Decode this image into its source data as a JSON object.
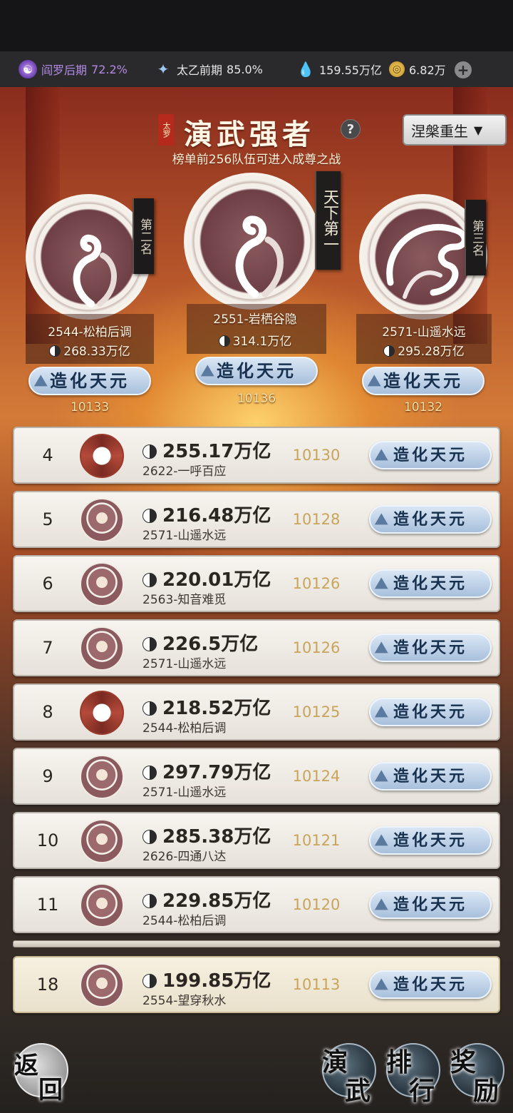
{
  "resources": {
    "realm1": {
      "label": "阎罗后期",
      "value": "72.2%"
    },
    "realm2": {
      "label": "太乙前期",
      "value": "85.0%"
    },
    "currency1": "159.55万亿",
    "currency2": "6.82万"
  },
  "header": {
    "badge": "太罗",
    "title": "演武强者",
    "subtitle": "榜单前256队伍可进入成尊之战",
    "dropdown_value": "涅槃重生"
  },
  "podium": [
    {
      "banner": "第二名",
      "name": "2544-松柏后调",
      "power": "268.33万亿",
      "realm": "造化天元",
      "score": "10133"
    },
    {
      "banner": "天下第一",
      "name": "2551-岩栖谷隐",
      "power": "314.1万亿",
      "realm": "造化天元",
      "score": "10136"
    },
    {
      "banner": "第三名",
      "name": "2571-山遥水远",
      "power": "295.28万亿",
      "realm": "造化天元",
      "score": "10132"
    }
  ],
  "rows": [
    {
      "rank": "4",
      "power": "255.17万亿",
      "team": "2622-一呼百应",
      "score": "10130",
      "realm": "造化天元",
      "emblem": "sword"
    },
    {
      "rank": "5",
      "power": "216.48万亿",
      "team": "2571-山遥水远",
      "score": "10128",
      "realm": "造化天元",
      "emblem": "swirl"
    },
    {
      "rank": "6",
      "power": "220.01万亿",
      "team": "2563-知音难觅",
      "score": "10126",
      "realm": "造化天元",
      "emblem": "swirl"
    },
    {
      "rank": "7",
      "power": "226.5万亿",
      "team": "2571-山遥水远",
      "score": "10126",
      "realm": "造化天元",
      "emblem": "swirl"
    },
    {
      "rank": "8",
      "power": "218.52万亿",
      "team": "2544-松柏后调",
      "score": "10125",
      "realm": "造化天元",
      "emblem": "sword"
    },
    {
      "rank": "9",
      "power": "297.79万亿",
      "team": "2571-山遥水远",
      "score": "10124",
      "realm": "造化天元",
      "emblem": "swirl"
    },
    {
      "rank": "10",
      "power": "285.38万亿",
      "team": "2626-四通八达",
      "score": "10121",
      "realm": "造化天元",
      "emblem": "swirl"
    },
    {
      "rank": "11",
      "power": "229.85万亿",
      "team": "2544-松柏后调",
      "score": "10120",
      "realm": "造化天元",
      "emblem": "swirl"
    }
  ],
  "my_row": {
    "rank": "18",
    "power": "199.85万亿",
    "team": "2554-望穿秋水",
    "score": "10113",
    "realm": "造化天元",
    "emblem": "swirl"
  },
  "nav": {
    "back": [
      "返",
      "回"
    ],
    "btn1": [
      "演",
      "武"
    ],
    "btn2": [
      "排",
      "行"
    ],
    "btn3": [
      "奖",
      "励"
    ]
  },
  "colors": {
    "realm_purple": "#b48ae8",
    "score_gold": "#c9a45a",
    "realm_button": "#a8c0dc"
  }
}
